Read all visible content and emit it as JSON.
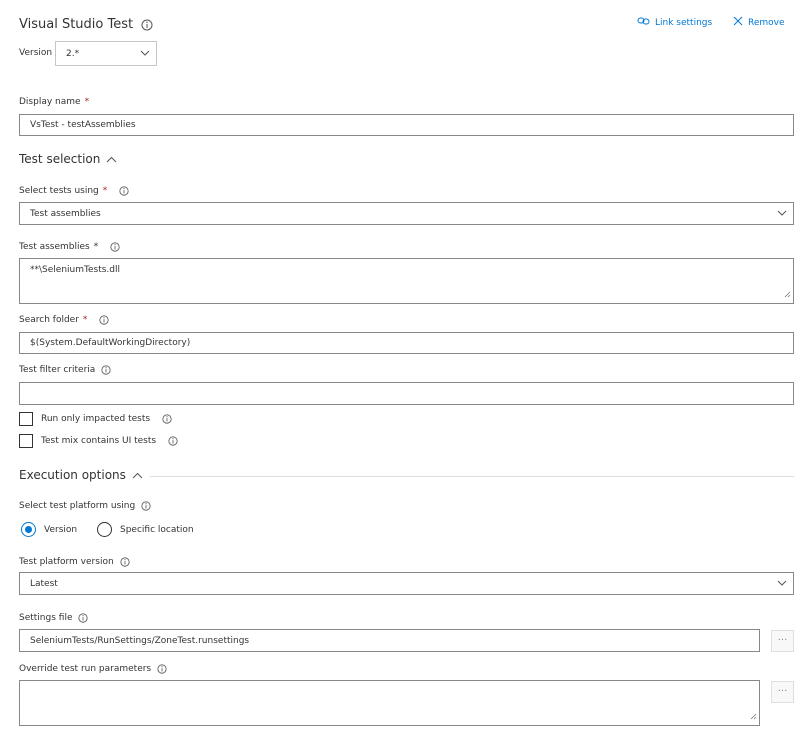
{
  "header": {
    "title": "Visual Studio Test",
    "link_settings": "Link settings",
    "remove": "Remove",
    "version_label": "Version",
    "version_value": "2.*"
  },
  "display_name": {
    "label": "Display name",
    "value": "VsTest - testAssemblies"
  },
  "test_selection": {
    "heading": "Test selection",
    "select_tests_using": {
      "label": "Select tests using",
      "value": "Test assemblies"
    },
    "test_assemblies": {
      "label": "Test assemblies",
      "value": "**\\SeleniumTests.dll"
    },
    "search_folder": {
      "label": "Search folder",
      "value": "$(System.DefaultWorkingDirectory)"
    },
    "test_filter": {
      "label": "Test filter criteria",
      "value": ""
    },
    "run_only_impacted": "Run only impacted tests",
    "ui_tests": "Test mix contains UI tests"
  },
  "execution_options": {
    "heading": "Execution options",
    "platform_using_label": "Select test platform using",
    "radio_version": "Version",
    "radio_specific": "Specific location",
    "platform_version": {
      "label": "Test platform version",
      "value": "Latest"
    },
    "settings_file": {
      "label": "Settings file",
      "value": "SeleniumTests/RunSettings/ZoneTest.runsettings"
    },
    "override_params": {
      "label": "Override test run parameters",
      "value": ""
    },
    "ellipsis": "···"
  },
  "required_marker": "*"
}
